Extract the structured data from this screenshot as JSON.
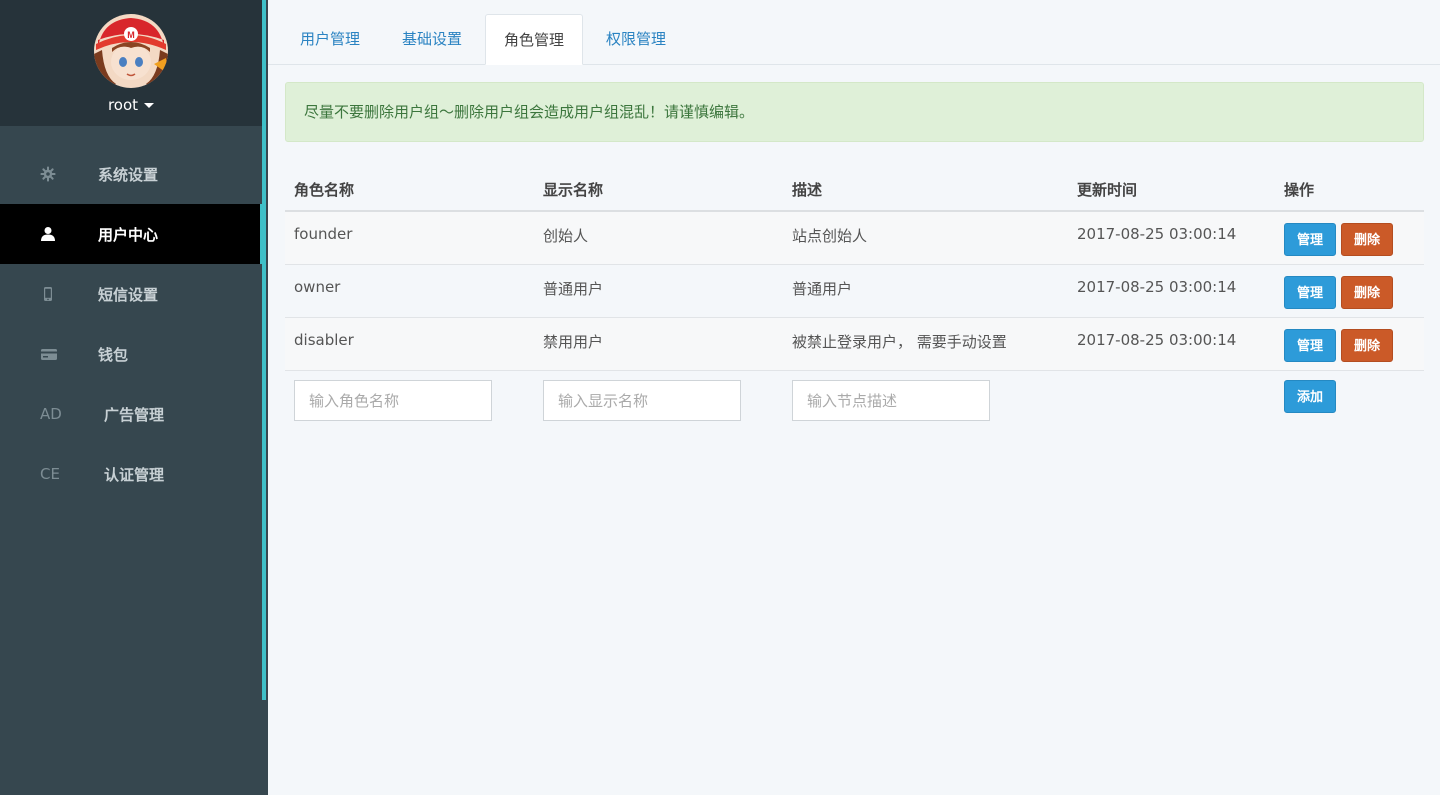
{
  "sidebar": {
    "user": {
      "name": "root"
    },
    "items": [
      {
        "label": "系统设置",
        "icon": "gear-icon",
        "active": false
      },
      {
        "label": "用户中心",
        "icon": "user-icon",
        "active": true
      },
      {
        "label": "短信设置",
        "icon": "phone-icon",
        "active": false
      },
      {
        "label": "钱包",
        "icon": "card-icon",
        "active": false
      },
      {
        "label": "广告管理",
        "icon_text": "AD",
        "active": false
      },
      {
        "label": "认证管理",
        "icon_text": "CE",
        "active": false
      }
    ]
  },
  "tabs": [
    {
      "label": "用户管理",
      "active": false
    },
    {
      "label": "基础设置",
      "active": false
    },
    {
      "label": "角色管理",
      "active": true
    },
    {
      "label": "权限管理",
      "active": false
    }
  ],
  "alert": {
    "text": "尽量不要删除用户组～删除用户组会造成用户组混乱！请谨慎编辑。"
  },
  "table": {
    "headers": [
      "角色名称",
      "显示名称",
      "描述",
      "更新时间",
      "操作"
    ],
    "rows": [
      {
        "name": "founder",
        "display": "创始人",
        "desc": "站点创始人",
        "time": "2017-08-25 03:00:14"
      },
      {
        "name": "owner",
        "display": "普通用户",
        "desc": "普通用户",
        "time": "2017-08-25 03:00:14"
      },
      {
        "name": "disabler",
        "display": "禁用用户",
        "desc": "被禁止登录用户， 需要手动设置",
        "time": "2017-08-25 03:00:14"
      }
    ],
    "actions": {
      "manage": "管理",
      "delete": "删除"
    },
    "add_row": {
      "name_placeholder": "输入角色名称",
      "display_placeholder": "输入显示名称",
      "desc_placeholder": "输入节点描述",
      "add_label": "添加"
    }
  },
  "colors": {
    "sidebar_bg": "#36474f",
    "accent": "#3fc0c8",
    "primary_button": "#2d9bd9",
    "danger_button": "#cb5a28",
    "alert_bg": "#dff0d8"
  }
}
